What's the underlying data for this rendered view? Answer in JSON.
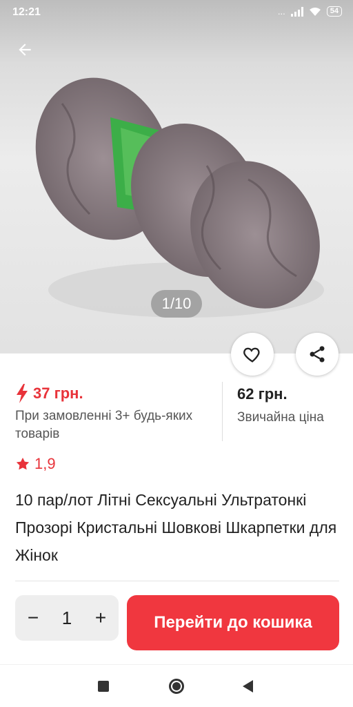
{
  "status_bar": {
    "time": "12:21",
    "signal_text": "...",
    "battery": "54"
  },
  "product_image": {
    "counter": "1/10",
    "description_icon": "product-photo"
  },
  "price": {
    "sale_price": "37 грн.",
    "sale_note": "При замовленні 3+ будь-яких товарів",
    "regular_price": "62 грн.",
    "regular_label": "Звичайна ціна"
  },
  "rating": {
    "value": "1,9"
  },
  "product": {
    "title": "10 пар/лот Літні Сексуальні Ультратонкі Прозорі Кристальні Шовкові Шкарпетки для Жінок"
  },
  "quantity": {
    "minus": "−",
    "value": "1",
    "plus": "+"
  },
  "cart_button": {
    "label": "Перейти до кошика"
  },
  "colors": {
    "accent": "#f0373f",
    "sale_red": "#e8333a",
    "stepper_bg": "#eeeeee"
  },
  "icons": [
    "back-arrow",
    "heart",
    "share",
    "lightning",
    "star",
    "nav-square",
    "nav-home",
    "nav-back"
  ]
}
